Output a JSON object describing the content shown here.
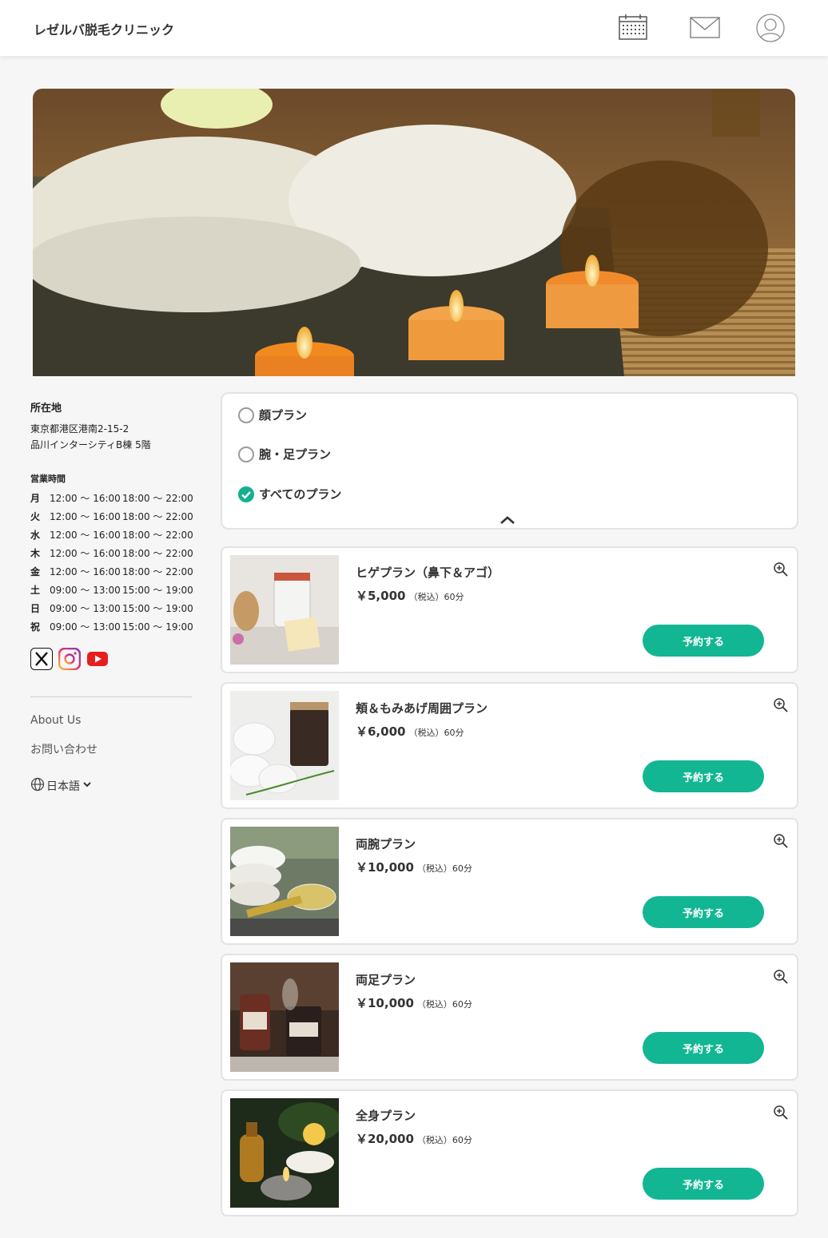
{
  "header": {
    "brand": "レゼルバ脱毛クリニック",
    "icons": [
      "calendar-icon",
      "mail-icon",
      "user-icon"
    ]
  },
  "sidebar": {
    "location_title": "所在地",
    "address_line1": "東京都港区港南2-15-2",
    "address_line2": "品川インターシティB棟 5階",
    "hours_title": "営業時間",
    "hours": [
      {
        "day": "月",
        "slot1": "12:00 〜 16:00",
        "slot2": "18:00 〜 22:00"
      },
      {
        "day": "火",
        "slot1": "12:00 〜 16:00",
        "slot2": "18:00 〜 22:00"
      },
      {
        "day": "水",
        "slot1": "12:00 〜 16:00",
        "slot2": "18:00 〜 22:00"
      },
      {
        "day": "木",
        "slot1": "12:00 〜 16:00",
        "slot2": "18:00 〜 22:00"
      },
      {
        "day": "金",
        "slot1": "12:00 〜 16:00",
        "slot2": "18:00 〜 22:00"
      },
      {
        "day": "土",
        "slot1": "09:00 〜 13:00",
        "slot2": "15:00 〜 19:00"
      },
      {
        "day": "日",
        "slot1": "09:00 〜 13:00",
        "slot2": "15:00 〜 19:00"
      },
      {
        "day": "祝",
        "slot1": "09:00 〜 13:00",
        "slot2": "15:00 〜 19:00"
      }
    ],
    "social": [
      "x-icon",
      "instagram-icon",
      "youtube-icon"
    ],
    "about": "About Us",
    "contact": "お問い合わせ",
    "language": "日本語"
  },
  "filter": {
    "options": [
      {
        "label": "顔プラン",
        "selected": false
      },
      {
        "label": "腕・足プラン",
        "selected": false
      },
      {
        "label": "すべてのプラン",
        "selected": true
      }
    ]
  },
  "plans": [
    {
      "name": "ヒゲプラン（鼻下＆アゴ）",
      "price": "￥5,000",
      "tax": "（税込）60分",
      "button": "予約する"
    },
    {
      "name": "頬＆もみあげ周囲プラン",
      "price": "￥6,000",
      "tax": "（税込）60分",
      "button": "予約する"
    },
    {
      "name": "両腕プラン",
      "price": "￥10,000",
      "tax": "（税込）60分",
      "button": "予約する"
    },
    {
      "name": "両足プラン",
      "price": "￥10,000",
      "tax": "（税込）60分",
      "button": "予約する"
    },
    {
      "name": "全身プラン",
      "price": "￥20,000",
      "tax": "（税込）60分",
      "button": "予約する"
    }
  ],
  "colors": {
    "accent": "#12b692",
    "checked": "#12b08f"
  }
}
